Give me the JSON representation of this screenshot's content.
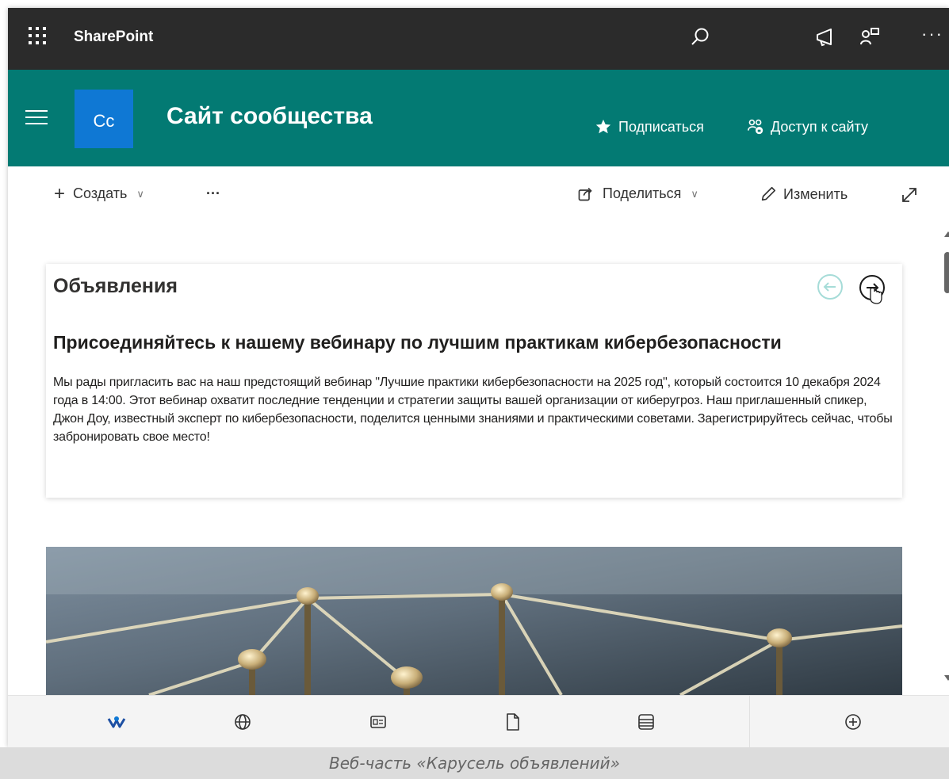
{
  "suite_bar": {
    "brand": "SharePoint",
    "background": "#2b2b2b",
    "icons": [
      "waffle-icon",
      "search-icon",
      "megaphone-icon",
      "people-icon",
      "more-icon"
    ],
    "more": "···"
  },
  "site_header": {
    "logo_text": "Cc",
    "title": "Сайт сообщества",
    "follow_label": "Подписаться",
    "access_label": "Доступ к сайту",
    "background": "#037a73",
    "logo_color": "#0f78d4"
  },
  "command_bar": {
    "new_label": "Создать",
    "more": "···",
    "share_label": "Поделиться",
    "edit_label": "Изменить"
  },
  "announcements": {
    "title": "Объявления",
    "item": {
      "heading": "Присоединяйтесь к нашему вебинару по лучшим практикам кибербезопасности",
      "body": "Мы рады пригласить вас на наш предстоящий вебинар \"Лучшие практики кибербезопасности на 2025 год\", который состоится 10 декабря 2024 года в 14:00. Этот вебинар охватит последние тенденции и стратегии защиты вашей организации от киберугроз. Наш приглашенный спикер, Джон Доу, известный эксперт по кибербезопасности, поделится ценными знаниями и практическими советами. Зарегистрируйтесь сейчас, чтобы забронировать свое место!"
    }
  },
  "toolbox": {
    "icons": [
      "viva-icon",
      "globe-icon",
      "news-icon",
      "document-icon",
      "list-icon",
      "add-icon"
    ]
  },
  "caption": "Веб-часть «Карусель объявлений»"
}
